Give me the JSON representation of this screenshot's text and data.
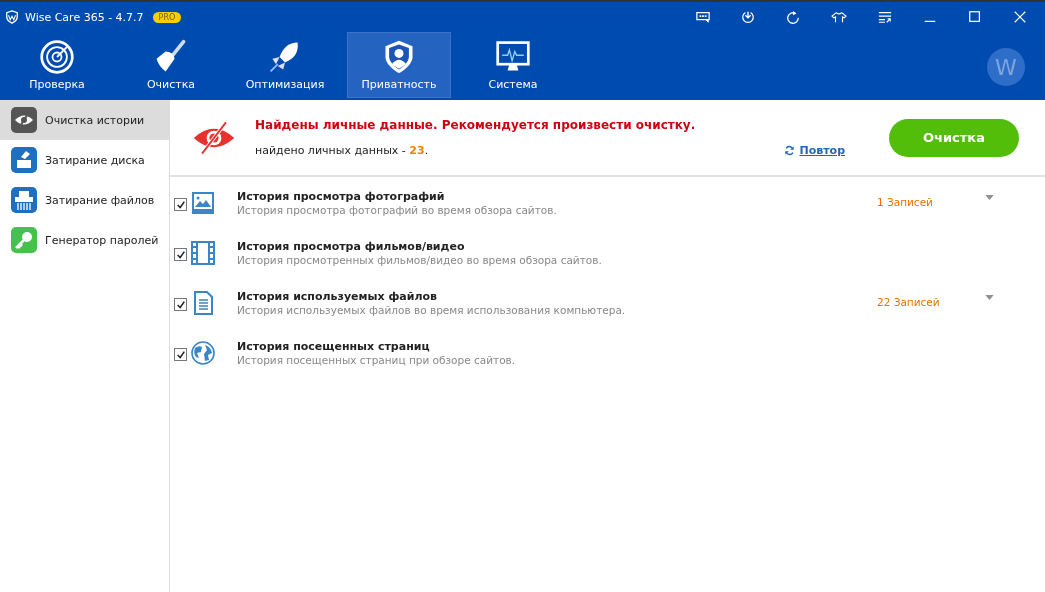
{
  "window": {
    "title": "Wise Care 365 - 4.7.7",
    "badge": "PRO"
  },
  "toolbar": [
    {
      "kind": "chat"
    },
    {
      "kind": "download"
    },
    {
      "kind": "refresh"
    },
    {
      "kind": "shirt"
    },
    {
      "kind": "list"
    },
    {
      "kind": "minimize"
    },
    {
      "kind": "maximize"
    },
    {
      "kind": "close"
    }
  ],
  "tabs": [
    {
      "label": "Проверка",
      "kind": "radar",
      "selected": false
    },
    {
      "label": "Очистка",
      "kind": "broom",
      "selected": false
    },
    {
      "label": "Оптимизация",
      "kind": "rocket",
      "selected": false
    },
    {
      "label": "Приватность",
      "kind": "shield",
      "selected": true
    },
    {
      "label": "Система",
      "kind": "monitor",
      "selected": false
    }
  ],
  "avatar": {
    "letter": "W"
  },
  "sidebar": {
    "items": [
      {
        "label": "Очистка истории",
        "kind": "eye",
        "selected": true
      },
      {
        "label": "Затирание диска",
        "kind": "disk",
        "selected": false
      },
      {
        "label": "Затирание файлов",
        "kind": "shredder",
        "selected": false
      },
      {
        "label": "Генератор паролей",
        "kind": "key",
        "selected": false
      }
    ]
  },
  "summary": {
    "headline": "Найдены личные данные. Рекомендуется произвести очистку.",
    "found_label": "найдено личных данных - ",
    "found_count": "23",
    "found_end": ".",
    "retry": "Повтор",
    "clean_button": "Очистка"
  },
  "items": [
    {
      "title": "История просмотра фотографий",
      "description": "История просмотра фотографий во время обзора сайтов.",
      "kind": "photo",
      "checked": true,
      "records": "1 Записей"
    },
    {
      "title": "История просмотра фильмов/видео",
      "description": "История просмотренных фильмов/видео во время обзора сайтов.",
      "kind": "film",
      "checked": true
    },
    {
      "title": "История используемых файлов",
      "description": "История используемых файлов во время использования компьютера.",
      "kind": "document",
      "checked": true,
      "records": "22 Записей"
    },
    {
      "title": "История посещенных страниц",
      "description": "История посещенных страниц при обзоре сайтов.",
      "kind": "globe",
      "checked": true
    }
  ]
}
